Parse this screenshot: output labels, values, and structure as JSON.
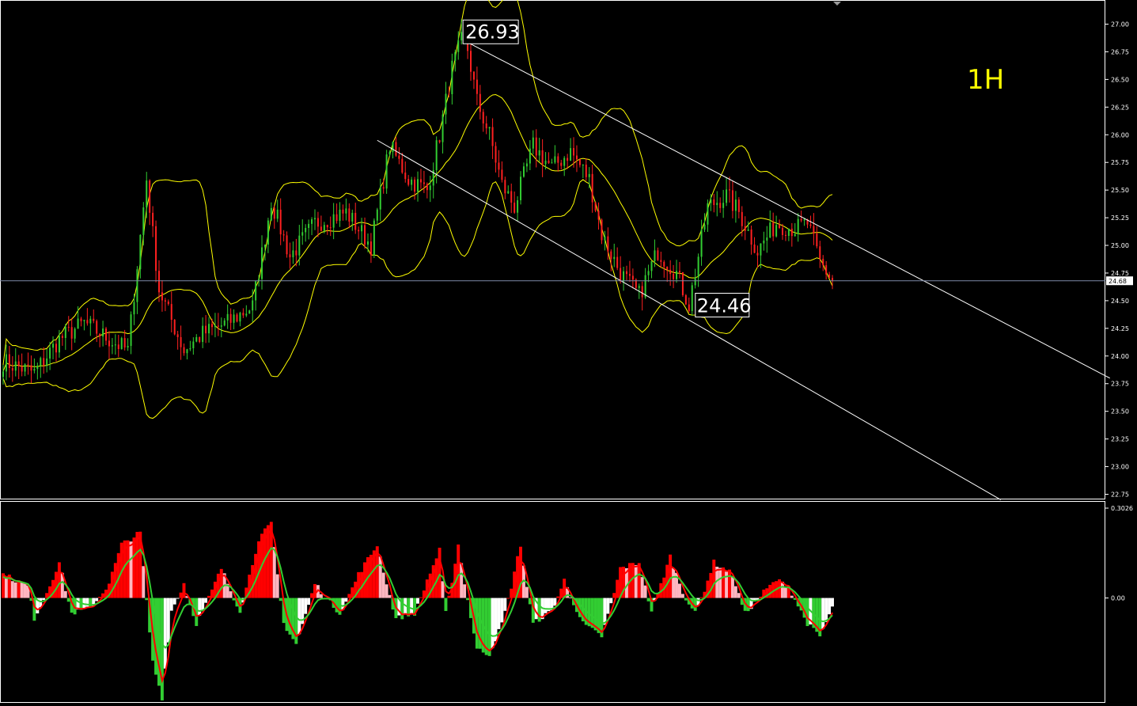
{
  "chart_data": [
    {
      "type": "candlestick",
      "panel": "price",
      "timeframe": "1H",
      "timeframe_color": "#ffff00",
      "ylim": [
        22.75,
        27.0
      ],
      "y_ticks": [
        "27.00",
        "26.75",
        "26.50",
        "26.25",
        "26.00",
        "25.75",
        "25.50",
        "25.25",
        "25.00",
        "24.75",
        "24.50",
        "24.25",
        "24.00",
        "23.75",
        "23.50",
        "23.25",
        "23.00",
        "22.75"
      ],
      "current_price": "24.68",
      "annotations": [
        {
          "label": "26.93",
          "value": 26.93,
          "bar": 148
        },
        {
          "label": "24.46",
          "value": 24.46,
          "bar": 220
        }
      ],
      "close_path": [
        [
          0,
          23.95
        ],
        [
          10,
          23.85
        ],
        [
          18,
          24.15
        ],
        [
          26,
          24.3
        ],
        [
          34,
          24.15
        ],
        [
          40,
          24.05
        ],
        [
          46,
          25.6
        ],
        [
          50,
          24.6
        ],
        [
          58,
          24.05
        ],
        [
          64,
          24.2
        ],
        [
          72,
          24.3
        ],
        [
          80,
          24.45
        ],
        [
          86,
          25.4
        ],
        [
          92,
          24.9
        ],
        [
          100,
          25.2
        ],
        [
          110,
          25.3
        ],
        [
          118,
          25.0
        ],
        [
          124,
          25.9
        ],
        [
          130,
          25.6
        ],
        [
          136,
          25.5
        ],
        [
          140,
          26.0
        ],
        [
          144,
          26.6
        ],
        [
          148,
          26.93
        ],
        [
          152,
          26.3
        ],
        [
          156,
          26.0
        ],
        [
          160,
          25.55
        ],
        [
          164,
          25.35
        ],
        [
          170,
          25.9
        ],
        [
          176,
          25.7
        ],
        [
          182,
          25.85
        ],
        [
          188,
          25.6
        ],
        [
          192,
          25.1
        ],
        [
          198,
          24.75
        ],
        [
          204,
          24.55
        ],
        [
          210,
          24.95
        ],
        [
          216,
          24.75
        ],
        [
          220,
          24.46
        ],
        [
          226,
          25.35
        ],
        [
          232,
          25.45
        ],
        [
          236,
          25.3
        ],
        [
          242,
          24.95
        ],
        [
          248,
          25.2
        ],
        [
          254,
          25.15
        ],
        [
          258,
          25.2
        ],
        [
          262,
          24.85
        ],
        [
          266,
          24.68
        ]
      ],
      "trendlines": [
        {
          "name": "upper-channel-line",
          "from": [
            148,
            26.85
          ],
          "to": [
            355,
            23.8
          ]
        },
        {
          "name": "lower-channel-line",
          "from": [
            120,
            25.95
          ],
          "to": [
            320,
            22.7
          ]
        }
      ],
      "bollinger_bands": {
        "color": "#ffff00"
      },
      "candle_colors": {
        "up": "#32cd32",
        "down": "#ff2020"
      }
    },
    {
      "type": "histogram-oscillator",
      "panel": "indicator",
      "y_ticks": [
        "0.3026",
        "0.00"
      ],
      "ylim": [
        -0.4,
        0.3026
      ],
      "histogram_colors": {
        "pos_rising": "#ff0000",
        "pos_falling": "#ffb6c1",
        "neg_falling": "#32cd32",
        "neg_rising": "#ffffff"
      },
      "lines": [
        {
          "name": "fast",
          "color": "#ff0000"
        },
        {
          "name": "slow",
          "color": "#32cd32"
        }
      ],
      "histogram_path": [
        [
          0,
          0.08
        ],
        [
          8,
          0.04
        ],
        [
          10,
          -0.08
        ],
        [
          14,
          0.02
        ],
        [
          18,
          0.12
        ],
        [
          22,
          -0.06
        ],
        [
          28,
          -0.04
        ],
        [
          34,
          0.05
        ],
        [
          38,
          0.18
        ],
        [
          44,
          0.22
        ],
        [
          48,
          -0.25
        ],
        [
          51,
          -0.39
        ],
        [
          54,
          -0.05
        ],
        [
          58,
          0.05
        ],
        [
          62,
          -0.1
        ],
        [
          70,
          0.1
        ],
        [
          76,
          -0.05
        ],
        [
          82,
          0.2
        ],
        [
          86,
          0.25
        ],
        [
          90,
          -0.1
        ],
        [
          94,
          -0.18
        ],
        [
          100,
          0.05
        ],
        [
          108,
          -0.06
        ],
        [
          114,
          0.08
        ],
        [
          120,
          0.18
        ],
        [
          126,
          -0.08
        ],
        [
          132,
          -0.06
        ],
        [
          136,
          0.06
        ],
        [
          140,
          0.16
        ],
        [
          142,
          -0.06
        ],
        [
          146,
          0.18
        ],
        [
          152,
          -0.2
        ],
        [
          156,
          -0.22
        ],
        [
          160,
          -0.1
        ],
        [
          166,
          0.18
        ],
        [
          170,
          -0.1
        ],
        [
          176,
          -0.05
        ],
        [
          180,
          0.06
        ],
        [
          186,
          -0.1
        ],
        [
          192,
          -0.15
        ],
        [
          198,
          0.1
        ],
        [
          204,
          0.12
        ],
        [
          208,
          -0.05
        ],
        [
          214,
          0.14
        ],
        [
          218,
          0.02
        ],
        [
          222,
          -0.06
        ],
        [
          228,
          0.12
        ],
        [
          234,
          0.08
        ],
        [
          238,
          -0.06
        ],
        [
          244,
          0.02
        ],
        [
          248,
          0.06
        ],
        [
          252,
          0.04
        ],
        [
          258,
          -0.1
        ],
        [
          262,
          -0.15
        ],
        [
          266,
          -0.04
        ]
      ]
    }
  ]
}
